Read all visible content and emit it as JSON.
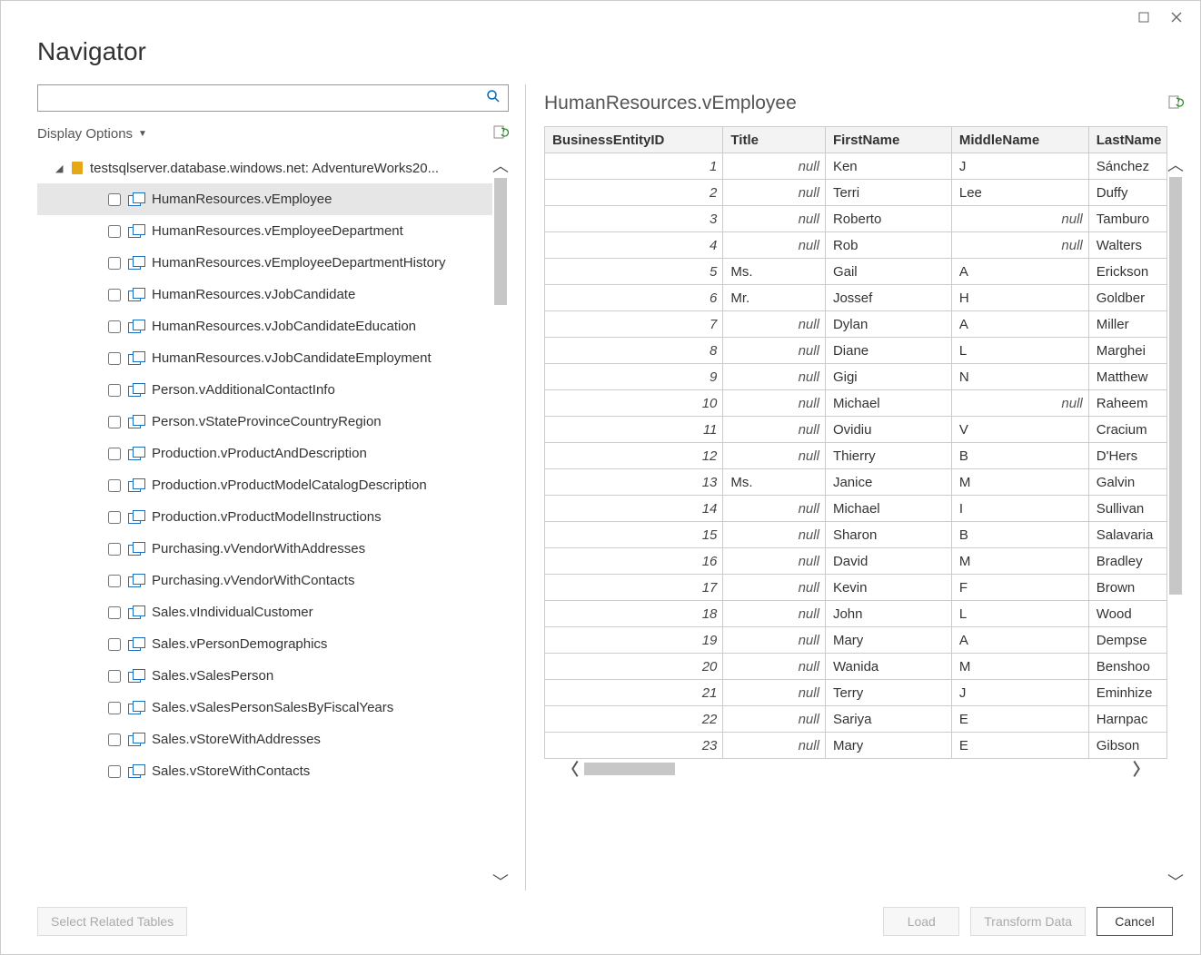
{
  "window": {
    "title": "Navigator"
  },
  "search": {
    "value": "",
    "placeholder": ""
  },
  "display_options_label": "Display Options",
  "tree": {
    "root_label": "testsqlserver.database.windows.net: AdventureWorks20...",
    "items": [
      {
        "label": "HumanResources.vEmployee",
        "selected": true
      },
      {
        "label": "HumanResources.vEmployeeDepartment",
        "selected": false
      },
      {
        "label": "HumanResources.vEmployeeDepartmentHistory",
        "selected": false
      },
      {
        "label": "HumanResources.vJobCandidate",
        "selected": false
      },
      {
        "label": "HumanResources.vJobCandidateEducation",
        "selected": false
      },
      {
        "label": "HumanResources.vJobCandidateEmployment",
        "selected": false
      },
      {
        "label": "Person.vAdditionalContactInfo",
        "selected": false
      },
      {
        "label": "Person.vStateProvinceCountryRegion",
        "selected": false
      },
      {
        "label": "Production.vProductAndDescription",
        "selected": false
      },
      {
        "label": "Production.vProductModelCatalogDescription",
        "selected": false
      },
      {
        "label": "Production.vProductModelInstructions",
        "selected": false
      },
      {
        "label": "Purchasing.vVendorWithAddresses",
        "selected": false
      },
      {
        "label": "Purchasing.vVendorWithContacts",
        "selected": false
      },
      {
        "label": "Sales.vIndividualCustomer",
        "selected": false
      },
      {
        "label": "Sales.vPersonDemographics",
        "selected": false
      },
      {
        "label": "Sales.vSalesPerson",
        "selected": false
      },
      {
        "label": "Sales.vSalesPersonSalesByFiscalYears",
        "selected": false
      },
      {
        "label": "Sales.vStoreWithAddresses",
        "selected": false
      },
      {
        "label": "Sales.vStoreWithContacts",
        "selected": false
      }
    ]
  },
  "preview": {
    "name": "HumanResources.vEmployee",
    "columns": [
      "BusinessEntityID",
      "Title",
      "FirstName",
      "MiddleName",
      "LastName"
    ],
    "rows": [
      {
        "id": "1",
        "title": null,
        "first": "Ken",
        "middle": "J",
        "last": "Sánchez"
      },
      {
        "id": "2",
        "title": null,
        "first": "Terri",
        "middle": "Lee",
        "last": "Duffy"
      },
      {
        "id": "3",
        "title": null,
        "first": "Roberto",
        "middle": null,
        "last": "Tamburo"
      },
      {
        "id": "4",
        "title": null,
        "first": "Rob",
        "middle": null,
        "last": "Walters"
      },
      {
        "id": "5",
        "title": "Ms.",
        "first": "Gail",
        "middle": "A",
        "last": "Erickson"
      },
      {
        "id": "6",
        "title": "Mr.",
        "first": "Jossef",
        "middle": "H",
        "last": "Goldber"
      },
      {
        "id": "7",
        "title": null,
        "first": "Dylan",
        "middle": "A",
        "last": "Miller"
      },
      {
        "id": "8",
        "title": null,
        "first": "Diane",
        "middle": "L",
        "last": "Marghei"
      },
      {
        "id": "9",
        "title": null,
        "first": "Gigi",
        "middle": "N",
        "last": "Matthew"
      },
      {
        "id": "10",
        "title": null,
        "first": "Michael",
        "middle": null,
        "last": "Raheem"
      },
      {
        "id": "11",
        "title": null,
        "first": "Ovidiu",
        "middle": "V",
        "last": "Cracium"
      },
      {
        "id": "12",
        "title": null,
        "first": "Thierry",
        "middle": "B",
        "last": "D'Hers"
      },
      {
        "id": "13",
        "title": "Ms.",
        "first": "Janice",
        "middle": "M",
        "last": "Galvin"
      },
      {
        "id": "14",
        "title": null,
        "first": "Michael",
        "middle": "I",
        "last": "Sullivan"
      },
      {
        "id": "15",
        "title": null,
        "first": "Sharon",
        "middle": "B",
        "last": "Salavaria"
      },
      {
        "id": "16",
        "title": null,
        "first": "David",
        "middle": "M",
        "last": "Bradley"
      },
      {
        "id": "17",
        "title": null,
        "first": "Kevin",
        "middle": "F",
        "last": "Brown"
      },
      {
        "id": "18",
        "title": null,
        "first": "John",
        "middle": "L",
        "last": "Wood"
      },
      {
        "id": "19",
        "title": null,
        "first": "Mary",
        "middle": "A",
        "last": "Dempse"
      },
      {
        "id": "20",
        "title": null,
        "first": "Wanida",
        "middle": "M",
        "last": "Benshoo"
      },
      {
        "id": "21",
        "title": null,
        "first": "Terry",
        "middle": "J",
        "last": "Eminhize"
      },
      {
        "id": "22",
        "title": null,
        "first": "Sariya",
        "middle": "E",
        "last": "Harnpac"
      },
      {
        "id": "23",
        "title": null,
        "first": "Mary",
        "middle": "E",
        "last": "Gibson"
      }
    ],
    "null_text": "null"
  },
  "footer": {
    "select_related": "Select Related Tables",
    "load": "Load",
    "transform": "Transform Data",
    "cancel": "Cancel"
  }
}
